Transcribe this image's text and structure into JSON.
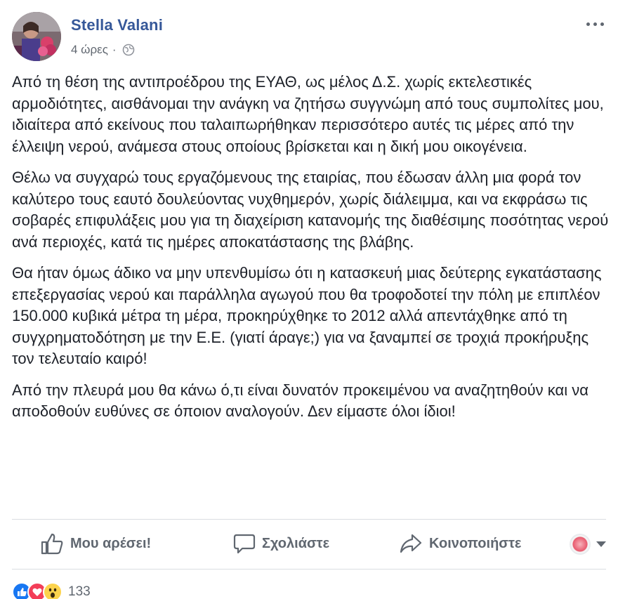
{
  "post": {
    "author": "Stella Valani",
    "timestamp": "4 ώρες",
    "separator": "·",
    "audience_icon": "globe-icon",
    "paragraphs": [
      "Από τη θέση της αντιπροέδρου της ΕΥΑΘ, ως μέλος Δ.Σ. χωρίς εκτελεστικές αρμοδιότητες, αισθάνομαι την ανάγκη να ζητήσω συγγνώμη από τους συμπολίτες μου, ιδιαίτερα από εκείνους που ταλαιπωρήθηκαν περισσότερο αυτές τις μέρες από την έλλειψη νερού, ανάμεσα στους οποίους βρίσκεται και η δική μου οικογένεια.",
      "Θέλω να συγχαρώ τους εργαζόμενους της εταιρίας, που έδωσαν άλλη μια φορά τον καλύτερο τους εαυτό δουλεύοντας νυχθημερόν, χωρίς διάλειμμα, και να εκφράσω τις σοβαρές επιφυλάξεις μου για τη διαχείριση κατανομής της διαθέσιμης ποσότητας νερού ανά περιοχές, κατά τις ημέρες αποκατάστασης της βλάβης.",
      "Θα ήταν όμως άδικο να μην υπενθυμίσω ότι η κατασκευή μιας δεύτερης εγκατάστασης επεξεργασίας νερού και παράλληλα αγωγού που θα τροφοδοτεί την πόλη με επιπλέον 150.000 κυβικά μέτρα τη μέρα, προκηρύχθηκε το 2012 αλλά απεντάχθηκε από τη συγχρηματοδότηση με την Ε.Ε. (γιατί άραγε;) για να ξαναμπεί σε τροχιά προκήρυξης τον τελευταίο καιρό!",
      "Από την πλευρά μου θα κάνω ό,τι είναι δυνατόν προκειμένου να αναζητηθούν και να αποδοθούν ευθύνες σε όποιον αναλογούν. Δεν είμαστε όλοι ίδιοι!"
    ]
  },
  "actions": {
    "like_label": "Μου αρέσει!",
    "comment_label": "Σχολιάστε",
    "share_label": "Κοινοποιήστε"
  },
  "reactions": {
    "types": [
      "like-icon",
      "love-icon",
      "wow-icon"
    ],
    "count": "133"
  },
  "colors": {
    "author_link": "#365899",
    "secondary_text": "#606770",
    "like_blue": "#1877f2",
    "love_red": "#f33e58",
    "wow_yellow": "#fcd34d"
  }
}
